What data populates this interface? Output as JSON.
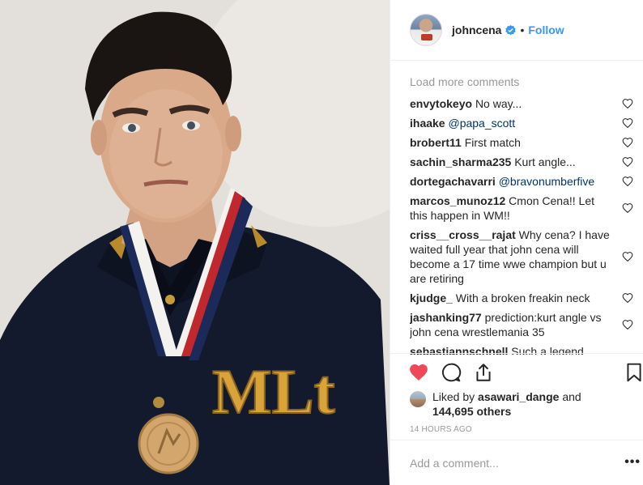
{
  "post": {
    "photo_alt": "Yearbook-style portrait in a dark letterman jacket with medal",
    "jacket_letters": "MLt"
  },
  "header": {
    "username": "johncena",
    "separator": "•",
    "follow_label": "Follow"
  },
  "comments": {
    "load_more_label": "Load more comments",
    "items": [
      {
        "user": "envytokeyo",
        "text": "No way...",
        "mention": ""
      },
      {
        "user": "ihaake",
        "text": "",
        "mention": "@papa_scott"
      },
      {
        "user": "brobert11",
        "text": "First match",
        "mention": ""
      },
      {
        "user": "sachin_sharma235",
        "text": "Kurt angle...",
        "mention": ""
      },
      {
        "user": "dortegachavarri",
        "text": "",
        "mention": "@bravonumberfive"
      },
      {
        "user": "marcos_munoz12",
        "text": "Cmon Cena!! Let this happen in WM!!",
        "mention": ""
      },
      {
        "user": "criss__cross__rajat",
        "text": "Why cena? I have waited full year that john cena will become a 17 time wwe champion but u are retiring",
        "mention": ""
      },
      {
        "user": "kjudge_",
        "text": "With a broken freakin neck",
        "mention": ""
      },
      {
        "user": "jashanking77",
        "text": "prediction:kurt angle vs john cena wrestlemania 35",
        "mention": ""
      },
      {
        "user": "sebastiannschnell",
        "text": "Such a legend dude.",
        "mention": ""
      }
    ]
  },
  "actions": {
    "liked_by_prefix": "Liked by",
    "liked_by_user": "asawari_dange",
    "liked_by_joiner": "and",
    "likes_count": "144,695 others",
    "timestamp": "14 HOURS AGO"
  },
  "add_comment": {
    "placeholder": "Add a comment...",
    "more_label": "•••"
  },
  "colors": {
    "like_red": "#ed4956",
    "link_blue": "#3897f0",
    "mention_blue": "#003569",
    "muted_gray": "#999999"
  },
  "icons": [
    "verified-badge-icon",
    "heart-icon",
    "comment-icon",
    "share-icon",
    "bookmark-icon",
    "heart-outline-icon"
  ]
}
